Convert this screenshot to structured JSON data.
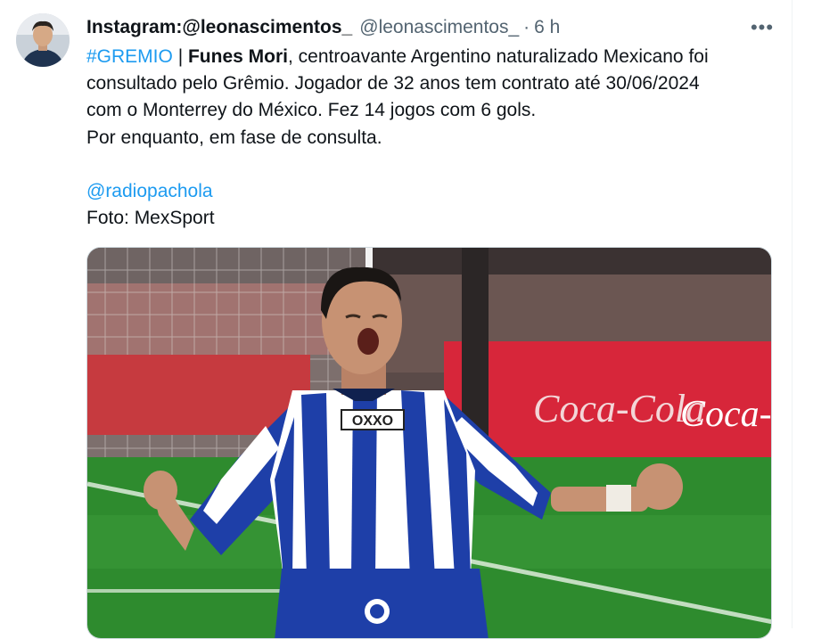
{
  "tweet": {
    "author_name": "Instagram:@leonascimentos_",
    "author_handle": "@leonascimentos_",
    "separator": "·",
    "time": "6 h",
    "more_icon": "•••",
    "lines": {
      "l1_hashtag": "#GREMIO",
      "l1_pipe": " | ",
      "l1_bold": "Funes Mori",
      "l1_rest": ", centroavante Argentino naturalizado Mexicano foi",
      "l2": "consultado pelo Grêmio. Jogador de 32 anos tem contrato até 30/06/2024",
      "l3": "com o Monterrey do México. Fez 14 jogos com 6 gols.",
      "l4": "Por enquanto, em fase de consulta.",
      "mention": "@radiopachola",
      "credit": "Foto: MexSport"
    },
    "media": {
      "jersey_sponsor": "OXXO",
      "ad_text_1": "Coca-Cola",
      "ad_text_2": "Coca-Cola"
    }
  },
  "colors": {
    "link": "#1d9bf0",
    "secondary_text": "#536471",
    "primary_text": "#0f1419",
    "ad_board_red": "#d7263a",
    "pitch_green": "#2e8b2e",
    "jersey_blue": "#1e3fa8"
  }
}
